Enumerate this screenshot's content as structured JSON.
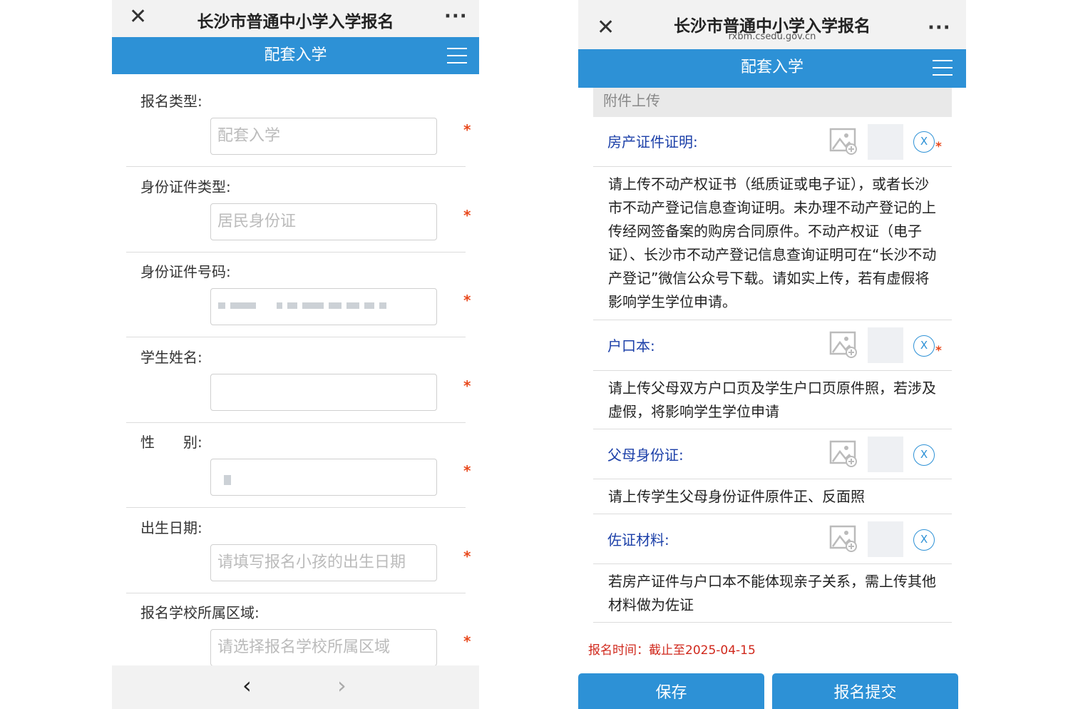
{
  "left": {
    "titlebar": {
      "close_icon": "close-icon",
      "title": "长沙市普通中小学入学报名",
      "more": "···"
    },
    "header": {
      "title": "配套入学",
      "menu_icon": "hamburger-icon"
    },
    "form": [
      {
        "label": "报名类型:",
        "placeholder": "配套入学",
        "required": "*"
      },
      {
        "label": "身份证件类型:",
        "placeholder": "居民身份证",
        "required": "*"
      },
      {
        "label": "身份证件号码:",
        "placeholder": "",
        "required": "*"
      },
      {
        "label": "学生姓名:",
        "placeholder": "",
        "required": "*"
      },
      {
        "label": "性　　别:",
        "placeholder": "",
        "required": "*"
      },
      {
        "label": "出生日期:",
        "placeholder": "请填写报名小孩的出生日期",
        "required": "*"
      },
      {
        "label": "报名学校所属区域:",
        "placeholder": "请选择报名学校所属区域",
        "required": "*"
      }
    ],
    "nav": {
      "back": "‹",
      "forward": "›"
    }
  },
  "right": {
    "titlebar": {
      "close_icon": "close-icon",
      "title": "长沙市普通中小学入学报名",
      "url": "rxbm.csedu.gov.cn",
      "more": "···"
    },
    "header": {
      "title": "配套入学",
      "menu_icon": "hamburger-icon"
    },
    "section": "附件上传",
    "uploads": [
      {
        "label": "房产证件证明:",
        "remove": "X",
        "required": "*",
        "desc": "请上传不动产权证书（纸质证或电子证），或者长沙市不动产登记信息查询证明。未办理不动产登记的上传经网签备案的购房合同原件。不动产权证（电子证）、长沙市不动产登记信息查询证明可在“长沙不动产登记”微信公众号下载。请如实上传，若有虚假将影响学生学位申请。"
      },
      {
        "label": "户口本:",
        "remove": "X",
        "required": "*",
        "desc": "请上传父母双方户口页及学生户口页原件照，若涉及虚假，将影响学生学位申请"
      },
      {
        "label": "父母身份证:",
        "remove": "X",
        "required": "",
        "desc": "请上传学生父母身份证件原件正、反面照"
      },
      {
        "label": "佐证材料:",
        "remove": "X",
        "required": "",
        "desc": "若房产证件与户口本不能体现亲子关系，需上传其他材料做为佐证"
      }
    ],
    "deadline": "报名时间：截止至2025-04-15",
    "buttons": {
      "save": "保存",
      "submit": "报名提交"
    }
  },
  "colors": {
    "accent": "#2d91d6",
    "required": "#e8491d",
    "deadline": "#d0281c",
    "label_blue": "#1b3fa8"
  }
}
